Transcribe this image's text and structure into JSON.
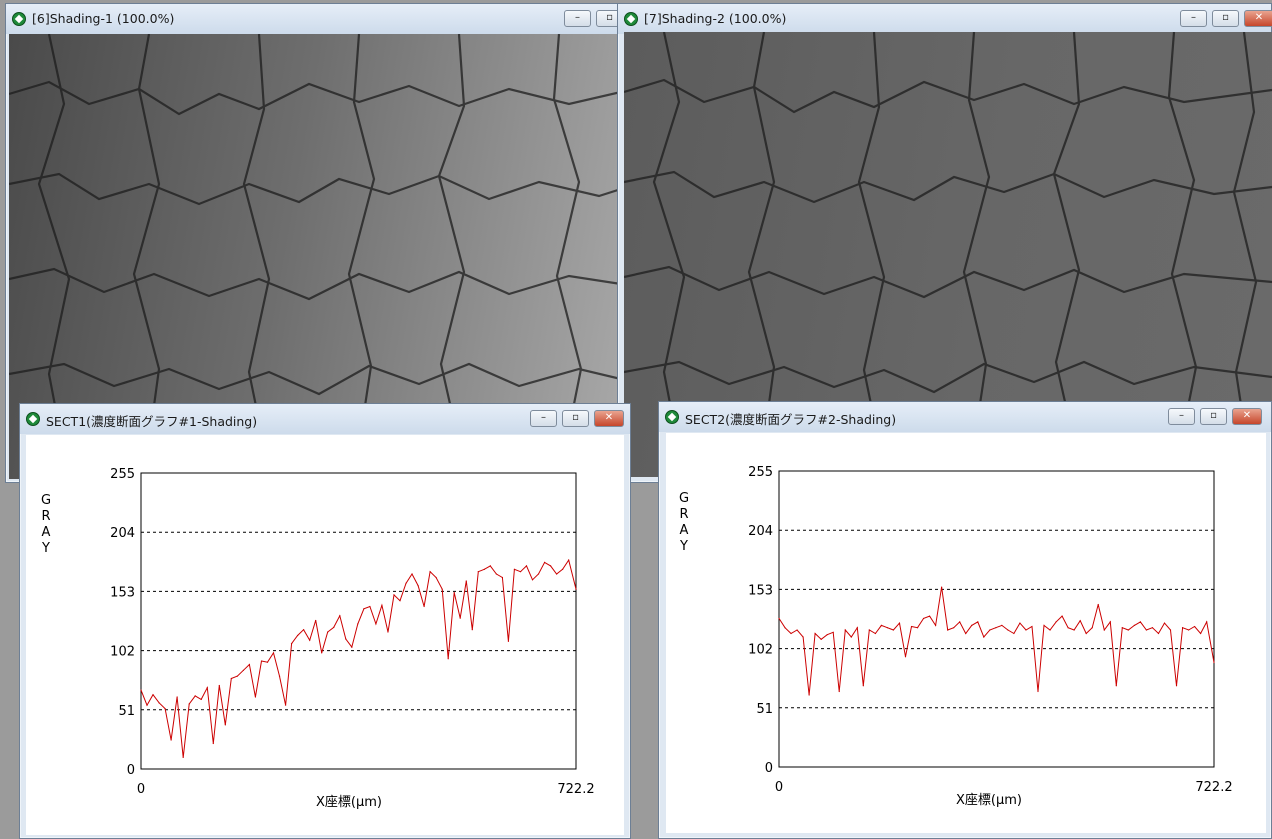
{
  "windows": {
    "shading1": {
      "title": "[6]Shading-1 (100.0%)"
    },
    "shading2": {
      "title": "[7]Shading-2 (100.0%)"
    },
    "sect1": {
      "title": "SECT1(濃度断面グラフ#1-Shading)"
    },
    "sect2": {
      "title": "SECT2(濃度断面グラフ#2-Shading)"
    }
  },
  "controls": {
    "minimize": "–",
    "maximize": "▫",
    "close": "✕"
  },
  "icons": {
    "app": "green-diamond-app-icon"
  },
  "colors": {
    "series": "#cc0000",
    "grid": "#000000",
    "plot_bg": "#ffffff"
  },
  "chart_data": [
    {
      "type": "line",
      "title": "SECT1(濃度断面グラフ#1-Shading)",
      "xlabel": "X座標(μm)",
      "ylabel": "GRAY",
      "xlim": [
        0,
        722.2
      ],
      "ylim": [
        0,
        255
      ],
      "x_ticks": [
        "0",
        "722.2"
      ],
      "y_ticks": [
        "0",
        "51",
        "102",
        "153",
        "204",
        "255"
      ],
      "grid": "horizontal dashed",
      "x": [
        0,
        10,
        20,
        30,
        40,
        50,
        60,
        70,
        80,
        90,
        100,
        110,
        120,
        130,
        140,
        150,
        160,
        170,
        180,
        190,
        200,
        210,
        220,
        230,
        240,
        250,
        260,
        270,
        280,
        290,
        300,
        310,
        320,
        330,
        340,
        350,
        360,
        370,
        380,
        390,
        400,
        410,
        420,
        430,
        440,
        450,
        460,
        470,
        480,
        490,
        500,
        510,
        520,
        530,
        540,
        550,
        560,
        570,
        580,
        590,
        600,
        610,
        620,
        630,
        640,
        650,
        660,
        670,
        680,
        690,
        700,
        710,
        722.2
      ],
      "values": [
        68,
        55,
        64,
        57,
        52,
        25,
        62,
        10,
        56,
        63,
        60,
        70,
        22,
        72,
        38,
        78,
        80,
        85,
        90,
        62,
        93,
        92,
        100,
        80,
        55,
        108,
        115,
        120,
        111,
        128,
        100,
        118,
        122,
        132,
        112,
        105,
        125,
        138,
        140,
        125,
        141,
        118,
        150,
        145,
        160,
        168,
        158,
        140,
        170,
        165,
        155,
        95,
        152,
        130,
        162,
        120,
        170,
        172,
        175,
        168,
        165,
        110,
        172,
        170,
        175,
        163,
        168,
        178,
        175,
        168,
        172,
        180,
        155
      ]
    },
    {
      "type": "line",
      "title": "SECT2(濃度断面グラフ#2-Shading)",
      "xlabel": "X座標(μm)",
      "ylabel": "GRAY",
      "xlim": [
        0,
        722.2
      ],
      "ylim": [
        0,
        255
      ],
      "x_ticks": [
        "0",
        "722.2"
      ],
      "y_ticks": [
        "0",
        "51",
        "102",
        "153",
        "204",
        "255"
      ],
      "grid": "horizontal dashed",
      "x": [
        0,
        10,
        20,
        30,
        40,
        50,
        60,
        70,
        80,
        90,
        100,
        110,
        120,
        130,
        140,
        150,
        160,
        170,
        180,
        190,
        200,
        210,
        220,
        230,
        240,
        250,
        260,
        270,
        280,
        290,
        300,
        310,
        320,
        330,
        340,
        350,
        360,
        370,
        380,
        390,
        400,
        410,
        420,
        430,
        440,
        450,
        460,
        470,
        480,
        490,
        500,
        510,
        520,
        530,
        540,
        550,
        560,
        570,
        580,
        590,
        600,
        610,
        620,
        630,
        640,
        650,
        660,
        670,
        680,
        690,
        700,
        710,
        722.2
      ],
      "values": [
        128,
        120,
        115,
        118,
        112,
        62,
        115,
        110,
        114,
        116,
        65,
        118,
        112,
        120,
        70,
        118,
        115,
        122,
        120,
        118,
        124,
        95,
        121,
        120,
        128,
        130,
        122,
        155,
        118,
        120,
        125,
        115,
        122,
        125,
        112,
        118,
        120,
        122,
        118,
        115,
        124,
        118,
        121,
        65,
        122,
        118,
        125,
        130,
        120,
        118,
        126,
        115,
        120,
        140,
        118,
        125,
        70,
        120,
        118,
        122,
        125,
        118,
        120,
        115,
        124,
        118,
        70,
        120,
        118,
        121,
        115,
        125,
        90
      ]
    }
  ]
}
